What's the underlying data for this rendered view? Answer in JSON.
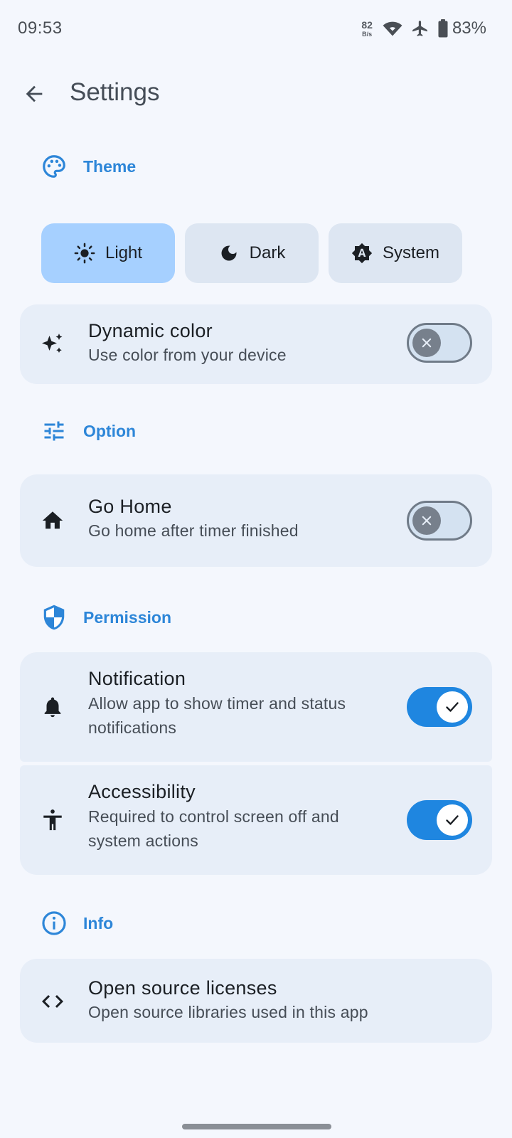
{
  "status_bar": {
    "time": "09:53",
    "net_speed_value": "82",
    "net_speed_unit": "B/s",
    "battery_percent": "83%",
    "icons": [
      "wifi-icon",
      "airplane-icon",
      "battery-icon"
    ]
  },
  "app_bar": {
    "title": "Settings",
    "back_icon": "arrow-back-icon"
  },
  "sections": {
    "theme": {
      "label": "Theme",
      "icon": "palette-icon"
    },
    "option": {
      "label": "Option",
      "icon": "tune-icon"
    },
    "permission": {
      "label": "Permission",
      "icon": "shield-icon"
    },
    "info": {
      "label": "Info",
      "icon": "info-icon"
    }
  },
  "theme_options": [
    {
      "label": "Light",
      "icon": "sun-icon",
      "selected": true
    },
    {
      "label": "Dark",
      "icon": "moon-icon",
      "selected": false
    },
    {
      "label": "System",
      "icon": "auto-brightness-icon",
      "selected": false
    }
  ],
  "settings": {
    "dynamic_color": {
      "title": "Dynamic color",
      "subtitle": "Use color from your device",
      "enabled": false,
      "icon": "sparkle-icon"
    },
    "go_home": {
      "title": "Go Home",
      "subtitle": "Go home after timer finished",
      "enabled": false,
      "icon": "home-icon"
    },
    "notification": {
      "title": "Notification",
      "subtitle": "Allow app to show timer and status notifications",
      "enabled": true,
      "icon": "bell-icon"
    },
    "accessibility": {
      "title": "Accessibility",
      "subtitle": "Required to control screen off and system actions",
      "enabled": true,
      "icon": "accessibility-icon"
    },
    "licenses": {
      "title": "Open source licenses",
      "subtitle": "Open source libraries used in this app",
      "icon": "code-icon"
    }
  },
  "colors": {
    "accent": "#2d86d8",
    "switch_on": "#1f86e0",
    "selected_segment": "#a6d0ff",
    "card_bg": "#e7eef8",
    "screen_bg": "#f4f7fd"
  }
}
